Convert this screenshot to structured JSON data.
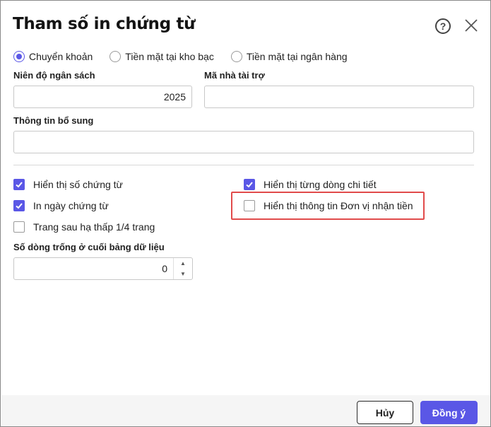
{
  "dialog": {
    "title": "Tham số in chứng từ",
    "help_icon": "question-circle-icon",
    "close_icon": "close-icon"
  },
  "payment_methods": {
    "options": [
      "Chuyển khoản",
      "Tiền mặt tại kho bạc",
      "Tiền mặt tại ngân hàng"
    ],
    "selected": "Chuyển khoản"
  },
  "fields": {
    "budget_year_label": "Niên độ ngân sách",
    "budget_year_value": "2025",
    "sponsor_code_label": "Mã nhà tài trợ",
    "sponsor_code_value": "",
    "additional_info_label": "Thông tin bổ sung",
    "additional_info_value": ""
  },
  "options": {
    "show_voucher_number": {
      "label": "Hiển thị số chứng từ",
      "checked": true
    },
    "print_voucher_date": {
      "label": "In ngày chứng từ",
      "checked": true
    },
    "lower_next_page": {
      "label": "Trang sau hạ thấp 1/4 trang",
      "checked": false
    },
    "show_detail_lines": {
      "label": "Hiển thị từng dòng chi tiết",
      "checked": true
    },
    "show_recipient_info": {
      "label": "Hiển thị thông tin Đơn vị nhận tiền",
      "checked": false
    }
  },
  "blank_lines": {
    "label": "Số dòng trống ở cuối bảng dữ liệu",
    "value": "0"
  },
  "footer": {
    "cancel_label": "Hủy",
    "ok_label": "Đồng ý"
  },
  "colors": {
    "accent": "#5a57e6",
    "highlight": "#e14b4b"
  }
}
